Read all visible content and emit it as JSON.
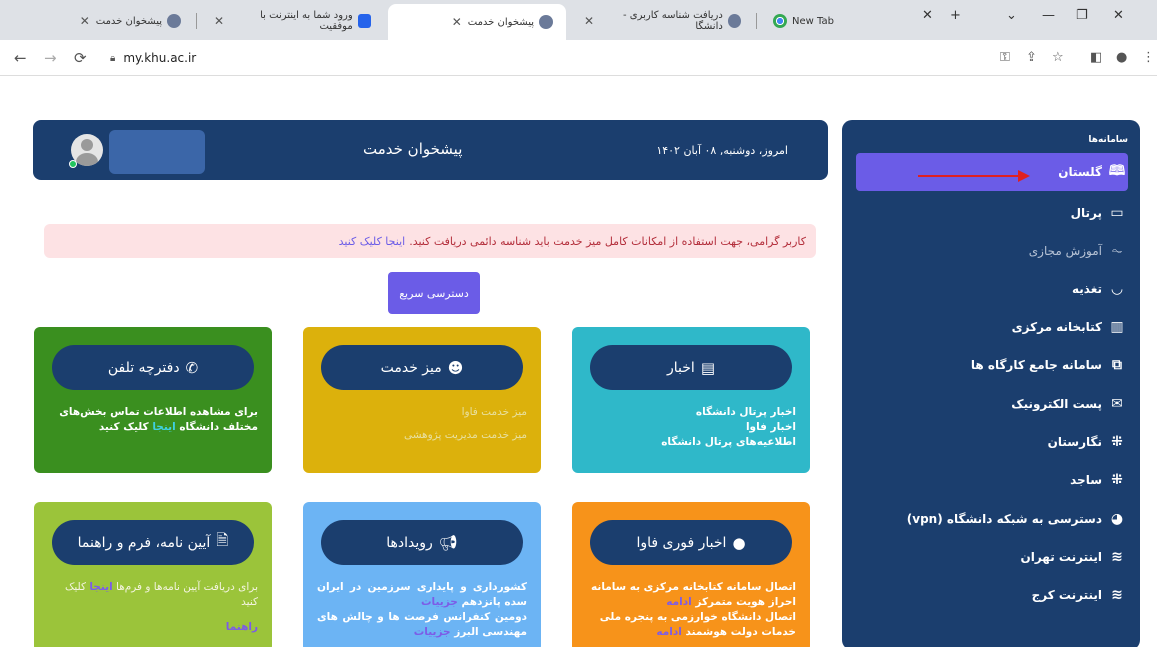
{
  "browser": {
    "tabs": [
      {
        "label": "پیشخوان خدمت",
        "favicon": "university"
      },
      {
        "label": "ورود شما به اینترنت با موفقیت",
        "favicon": "blue-s"
      },
      {
        "label": "پیشخوان خدمت",
        "favicon": "university",
        "active": true
      },
      {
        "label": "دریافت شناسه کاربری - دانشگا",
        "favicon": "university"
      },
      {
        "label": "New Tab",
        "favicon": "chrome"
      }
    ],
    "url": "my.khu.ac.ir"
  },
  "sidebar": {
    "header": "سامانه‌ها",
    "items": [
      {
        "label": "گلستان",
        "icon": "book-icon",
        "active": true
      },
      {
        "label": "پرتال",
        "icon": "window-icon"
      },
      {
        "label": "آموزش مجازی",
        "icon": "pulse-icon",
        "muted": true
      },
      {
        "label": "تغذیه",
        "icon": "food-icon"
      },
      {
        "label": "کتابخانه مرکزی",
        "icon": "library-icon"
      },
      {
        "label": "سامانه جامع کارگاه ها",
        "icon": "workshop-icon"
      },
      {
        "label": "پست الکترونیک",
        "icon": "mail-icon"
      },
      {
        "label": "نگارستان",
        "icon": "slack-icon"
      },
      {
        "label": "ساجد",
        "icon": "slack-icon"
      },
      {
        "label": "دسترسی به شبکه دانشگاه (vpn)",
        "icon": "globe-icon"
      },
      {
        "label": "اینترنت تهران",
        "icon": "wifi-icon"
      },
      {
        "label": "اینترنت کرج",
        "icon": "wifi-icon"
      }
    ]
  },
  "header": {
    "title": "پیشخوان خدمت",
    "date": "امروز، دوشنبه, ۰۸ آبان ۱۴۰۲"
  },
  "alert": {
    "text": "کاربر گرامی، جهت استفاده از امکانات کامل میز خدمت باید شناسه دائمی دریافت کنید.",
    "link": "اینجا کلیک کنید"
  },
  "quick_access": "دسترسی سریع",
  "cards": {
    "news": {
      "title": "اخبار",
      "lines": [
        "اخبار پرتال دانشگاه",
        "اخبار فاوا",
        "اطلاعیه‌های پرتال دانشگاه"
      ]
    },
    "service_desk": {
      "title": "میز خدمت",
      "lines": [
        "میز خدمت فاوا",
        "میز خدمت مدیریت پژوهشی"
      ]
    },
    "phonebook": {
      "title": "دفترچه تلفن",
      "text_before": "برای مشاهده اطلاعات تماس بخش‌های مختلف دانشگاه",
      "link": "اینجا",
      "text_after": "کلیک کنید"
    },
    "urgent_news": {
      "title": "اخبار فوری فاوا",
      "items": [
        {
          "text": "اتصال سامانه کتابخانه مرکزی به سامانه احراز هویت متمرکز",
          "link": "ادامه"
        },
        {
          "text": "اتصال دانشگاه خوارزمی به پنجره ملی خدمات دولت هوشمند",
          "link": "ادامه"
        }
      ]
    },
    "events": {
      "title": "رویدادها",
      "items": [
        {
          "text": "کشورداری و پایداری سرزمین در ایران سده پانزدهم",
          "link": "جزییات"
        },
        {
          "text": "دومین کنفرانس فرصت ها و چالش های مهندسی البرز",
          "link": "جزییات"
        }
      ]
    },
    "regulations": {
      "title": "آیین نامه، فرم و راهنما",
      "text_before": "برای دریافت آیین نامه‌ها و فرم‌ها",
      "link": "اینجا",
      "text_after": "کلیک کنید",
      "extra": "راهنما"
    }
  },
  "colors": {
    "navy": "#1b3e6e",
    "purple": "#6b5ce7",
    "green": "#3a8f1f",
    "yellow": "#dcb10c",
    "cyan": "#2fb8c9",
    "orange": "#f7931a",
    "blue": "#6cb4f4",
    "lime": "#9bc43a"
  }
}
